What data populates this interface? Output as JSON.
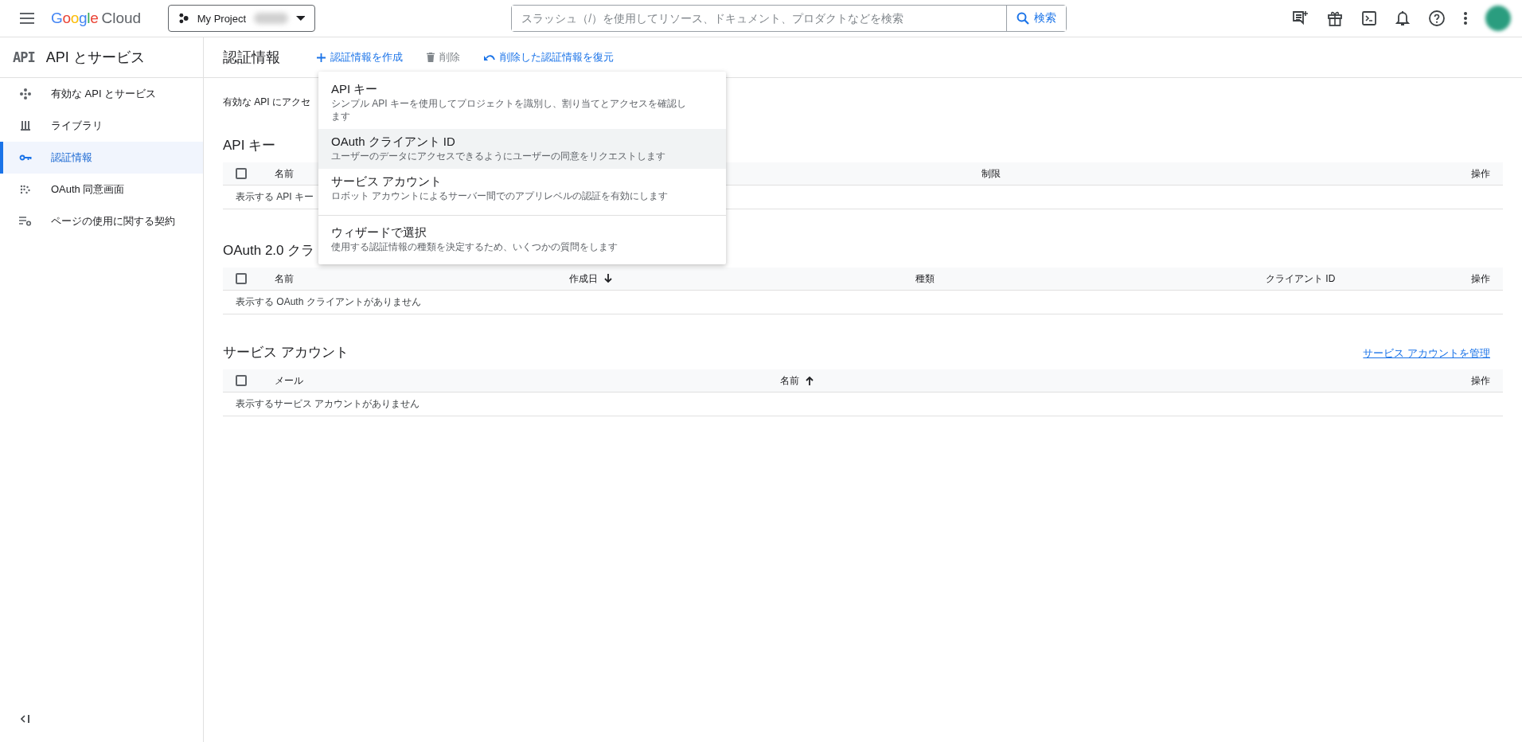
{
  "topbar": {
    "brand": "Google",
    "product": "Cloud",
    "project": "My Project",
    "search": {
      "placeholder": "スラッシュ（/）を使用してリソース、ドキュメント、プロダクトなどを検索",
      "button": "検索"
    }
  },
  "sidebar": {
    "badge": "API",
    "title": "API とサービス",
    "items": [
      {
        "label": "有効な API とサービス",
        "kind": "dashboard",
        "selected": false
      },
      {
        "label": "ライブラリ",
        "kind": "library",
        "selected": false
      },
      {
        "label": "認証情報",
        "kind": "key",
        "selected": true
      },
      {
        "label": "OAuth 同意画面",
        "kind": "consent",
        "selected": false
      },
      {
        "label": "ページの使用に関する契約",
        "kind": "agreement",
        "selected": false
      }
    ]
  },
  "page": {
    "title": "認証情報",
    "actions": [
      {
        "label": "認証情報を作成",
        "kind": "create",
        "disabled": false
      },
      {
        "label": "削除",
        "kind": "delete",
        "disabled": true
      },
      {
        "label": "削除した認証情報を復元",
        "kind": "restore",
        "disabled": false
      }
    ],
    "description": "有効な API にアクセ",
    "sections": [
      {
        "title": "API キー",
        "columns": [
          {
            "label": "名前"
          },
          {
            "label": "制限"
          },
          {
            "label": "操作"
          }
        ],
        "empty": "表示する API キー",
        "checked": false
      },
      {
        "title": "OAuth 2.0 クラ",
        "columns": [
          {
            "label": "名前"
          },
          {
            "label": "作成日",
            "sorted": true,
            "ascending": false
          },
          {
            "label": "種類"
          },
          {
            "label": "クライアント ID"
          },
          {
            "label": "操作"
          }
        ],
        "empty": "表示する OAuth クライアントがありません",
        "checked": false
      },
      {
        "title": "サービス アカウント",
        "link": "サービス アカウントを管理",
        "columns": [
          {
            "label": "メール"
          },
          {
            "label": "名前",
            "sorted": true,
            "ascending": true
          },
          {
            "label": "操作"
          }
        ],
        "empty": "表示するサービス アカウントがありません",
        "checked": false
      }
    ]
  },
  "menu": {
    "items": [
      {
        "title": "API キー",
        "description": "シンプル API キーを使用してプロジェクトを識別し、割り当てとアクセスを確認します",
        "selected": false,
        "separated": false
      },
      {
        "title": "OAuth クライアント ID",
        "description": "ユーザーのデータにアクセスできるようにユーザーの同意をリクエストします",
        "selected": true,
        "separated": false
      },
      {
        "title": "サービス アカウント",
        "description": "ロボット アカウントによるサーバー間でのアプリレベルの認証を有効にします",
        "selected": false,
        "separated": false
      },
      {
        "title": "ウィザードで選択",
        "description": "使用する認証情報の種類を決定するため、いくつかの質問をします",
        "selected": false,
        "separated": true
      }
    ]
  }
}
